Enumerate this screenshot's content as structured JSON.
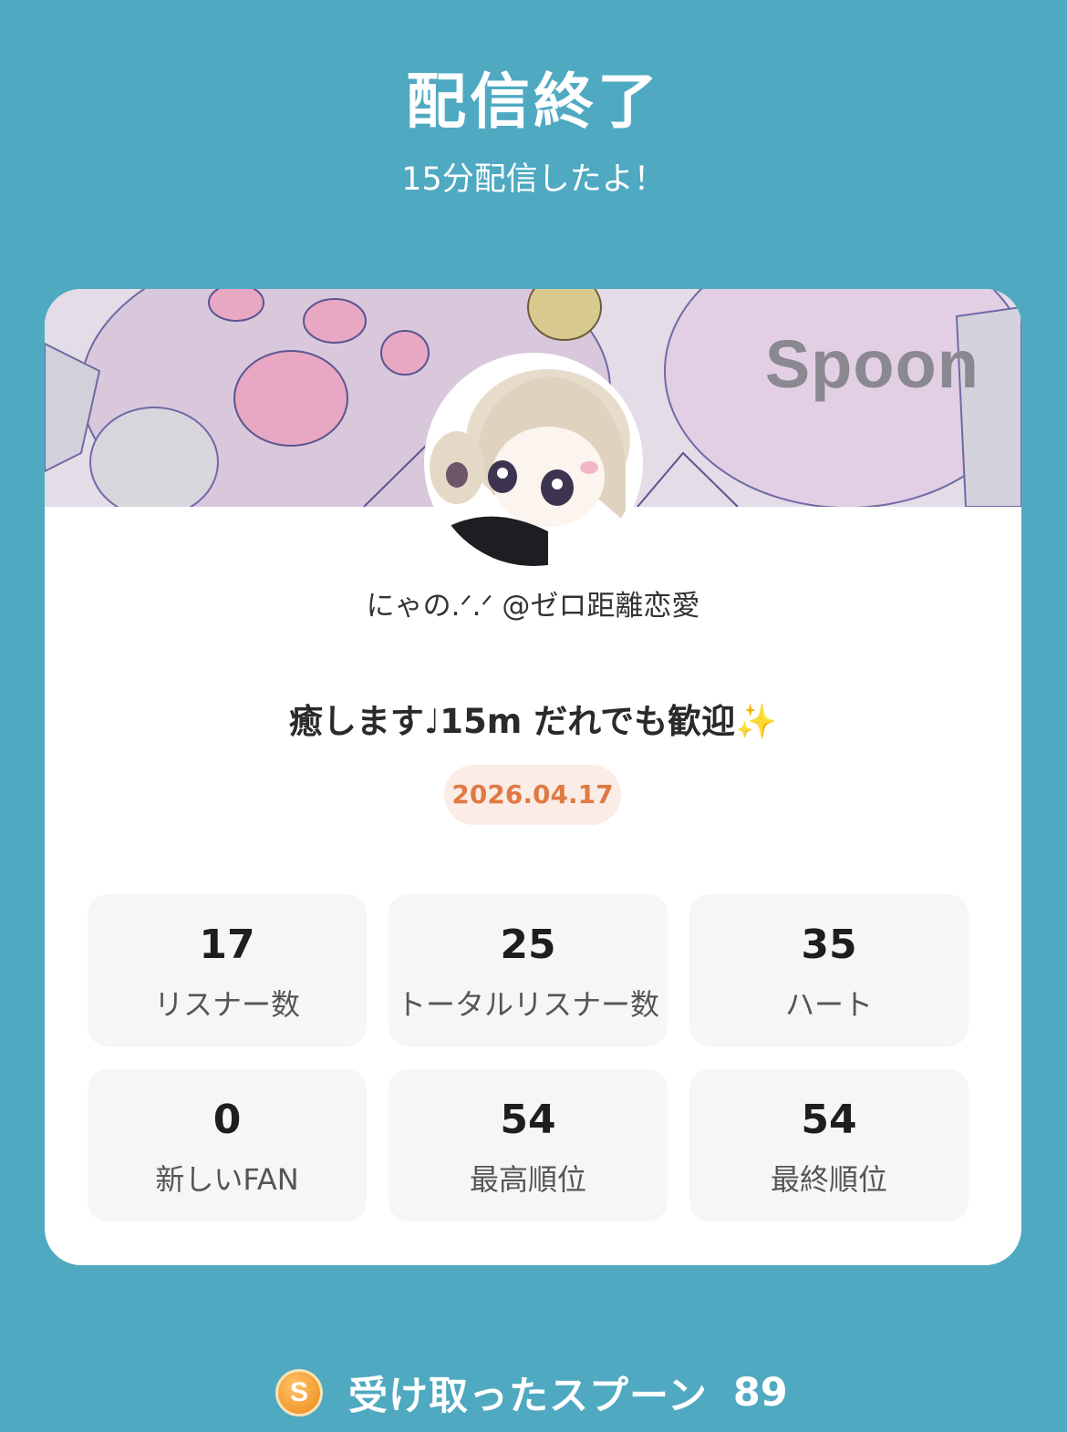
{
  "header": {
    "title": "配信終了",
    "subtitle": "15分配信したよ！"
  },
  "card": {
    "banner_logo": "Spoon",
    "username": "にゃの.ᐟ.ᐟ @ゼロ距離恋愛",
    "stream_title": "癒します♩15m だれでも歓迎✨",
    "date": "2026.04.17"
  },
  "stats": [
    {
      "value": "17",
      "label": "リスナー数"
    },
    {
      "value": "25",
      "label": "トータルリスナー数"
    },
    {
      "value": "35",
      "label": "ハート"
    },
    {
      "value": "0",
      "label": "新しいFAN"
    },
    {
      "value": "54",
      "label": "最高順位"
    },
    {
      "value": "54",
      "label": "最終順位"
    }
  ],
  "footer": {
    "coin_letter": "S",
    "label": "受け取ったスプーン",
    "count": "89"
  },
  "colors": {
    "background": "#4fa9c1",
    "card": "#ffffff",
    "stat_tile": "#f6f6f6",
    "date_text": "#e07a45",
    "date_bg": "#fbece6",
    "coin": "#f29a2e"
  }
}
